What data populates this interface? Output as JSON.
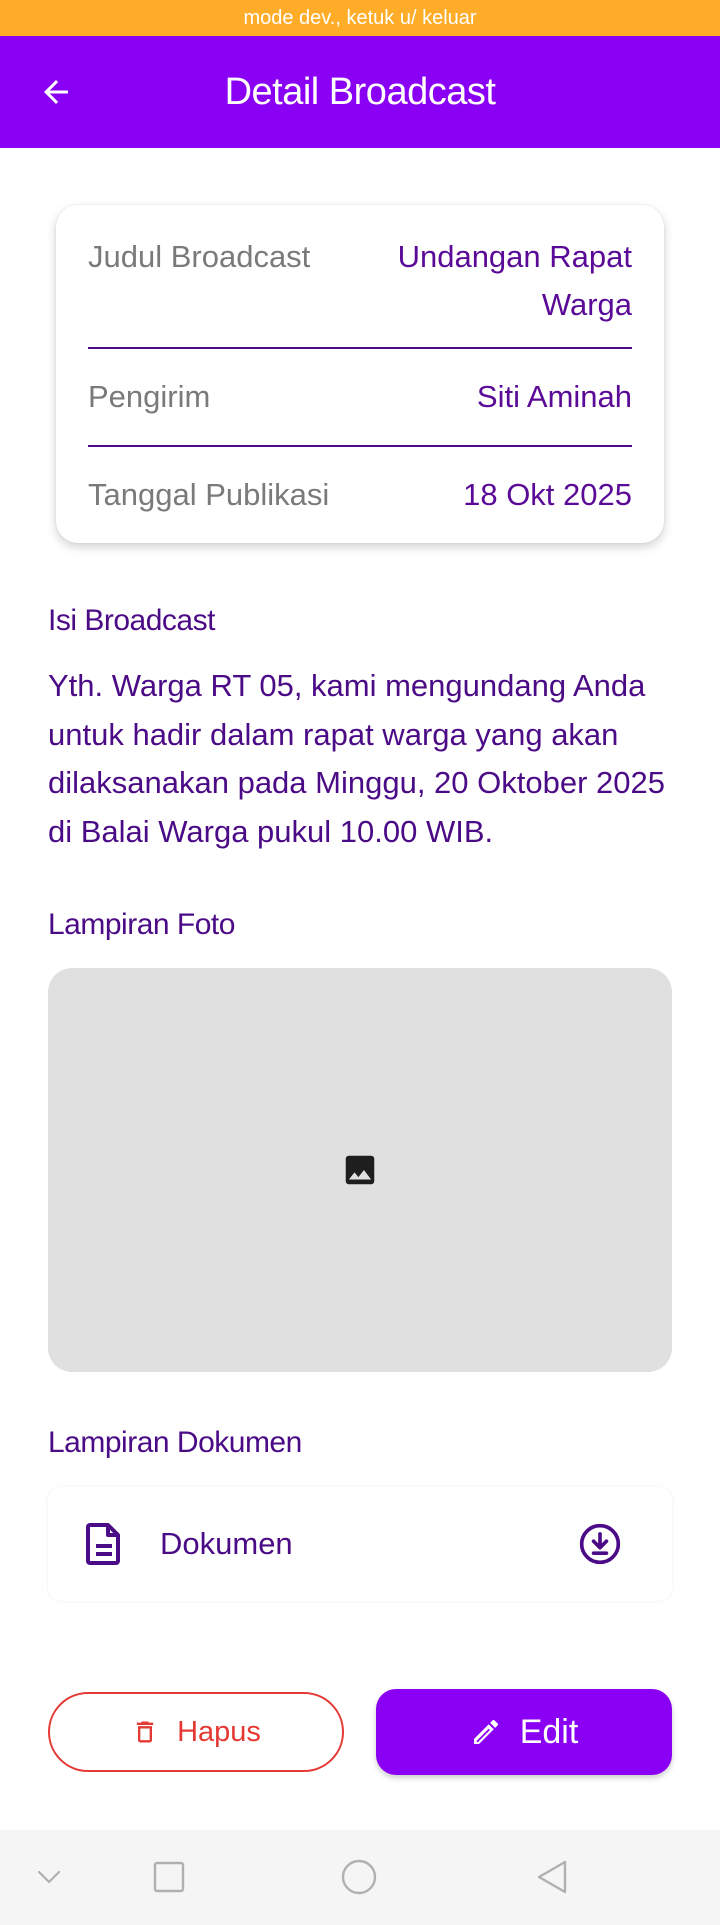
{
  "dev_banner": "mode dev., ketuk u/ keluar",
  "appbar": {
    "title": "Detail Broadcast"
  },
  "info": {
    "title_label": "Judul Broadcast",
    "title_value_line1": "Undangan Rapat",
    "title_value_line2": "Warga",
    "sender_label": "Pengirim",
    "sender_value": "Siti Aminah",
    "date_label": "Tanggal Publikasi",
    "date_value": "18 Okt 2025"
  },
  "content": {
    "heading": "Isi Broadcast",
    "line1": "Yth. Warga RT 05, kami mengundang Anda",
    "line2": "untuk hadir dalam rapat warga yang akan",
    "line3": "dilaksanakan pada Minggu, 20 Oktober 2025",
    "line4": "di Balai Warga pukul 10.00 WIB."
  },
  "photo": {
    "heading": "Lampiran Foto",
    "icon": "image-icon"
  },
  "document": {
    "heading": "Lampiran Dokumen",
    "label": "Dokumen",
    "icon": "document-icon",
    "action_icon": "download-icon"
  },
  "actions": {
    "delete_label": "Hapus",
    "edit_label": "Edit"
  },
  "colors": {
    "primary": "#8a00f4",
    "text_purple": "#4b0a86",
    "danger": "#e53935",
    "dev_banner": "#ffac28"
  },
  "system_nav": [
    "chevron-down-icon",
    "recents-icon",
    "home-icon",
    "back-icon"
  ]
}
